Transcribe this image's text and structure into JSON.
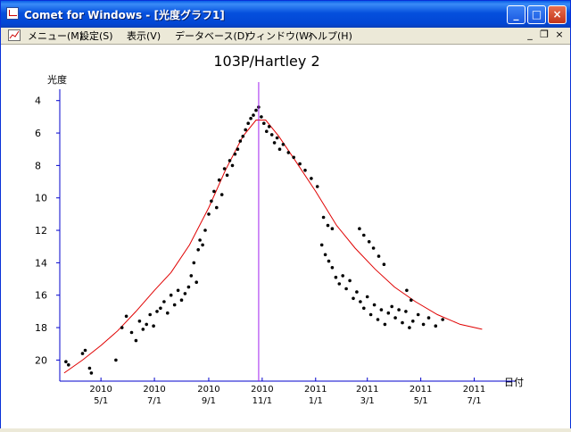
{
  "window": {
    "title": "Comet for Windows - [光度グラフ1]",
    "minimize_icon": "minimize-icon",
    "maximize_icon": "maximize-icon",
    "close_icon": "close-icon"
  },
  "menu": {
    "items": [
      {
        "label": "メニュー(M)"
      },
      {
        "label": "設定(S)"
      },
      {
        "label": "表示(V)"
      },
      {
        "label": "データベース(D)"
      },
      {
        "label": "ウィンドウ(W)"
      },
      {
        "label": "ヘルプ(H)"
      }
    ],
    "mdi_minimize": "_",
    "mdi_restore": "❐",
    "mdi_close": "×"
  },
  "chart_data": {
    "type": "scatter",
    "title": "103P/Hartley 2",
    "ylabel": "光度",
    "xlabel": "日付",
    "y_inverted": true,
    "ylim": [
      21.3,
      3.3
    ],
    "yticks": [
      4,
      6,
      8,
      10,
      12,
      14,
      16,
      18,
      20
    ],
    "xticks": [
      {
        "year": "2010",
        "date": "5/1"
      },
      {
        "year": "2010",
        "date": "7/1"
      },
      {
        "year": "2010",
        "date": "9/1"
      },
      {
        "year": "2010",
        "date": "11/1"
      },
      {
        "year": "2011",
        "date": "1/1"
      },
      {
        "year": "2011",
        "date": "3/1"
      },
      {
        "year": "2011",
        "date": "5/1"
      },
      {
        "year": "2011",
        "date": "7/1"
      }
    ],
    "perihelion_marker": "2010-10-28",
    "colors": {
      "observations": "#000000",
      "model_curve": "#e00000",
      "perihelion_line": "#a020f0",
      "axis": "#0000cc"
    },
    "model_curve": [
      {
        "x": "2010-03-20",
        "y": 20.8
      },
      {
        "x": "2010-04-10",
        "y": 20.0
      },
      {
        "x": "2010-05-01",
        "y": 19.1
      },
      {
        "x": "2010-05-20",
        "y": 18.2
      },
      {
        "x": "2010-06-10",
        "y": 17.0
      },
      {
        "x": "2010-07-01",
        "y": 15.7
      },
      {
        "x": "2010-07-20",
        "y": 14.6
      },
      {
        "x": "2010-08-10",
        "y": 12.9
      },
      {
        "x": "2010-09-01",
        "y": 10.6
      },
      {
        "x": "2010-09-20",
        "y": 8.3
      },
      {
        "x": "2010-10-10",
        "y": 6.2
      },
      {
        "x": "2010-10-25",
        "y": 5.2
      },
      {
        "x": "2010-11-05",
        "y": 5.2
      },
      {
        "x": "2010-11-20",
        "y": 6.2
      },
      {
        "x": "2010-12-10",
        "y": 7.8
      },
      {
        "x": "2011-01-01",
        "y": 9.6
      },
      {
        "x": "2011-01-25",
        "y": 11.7
      },
      {
        "x": "2011-02-15",
        "y": 13.1
      },
      {
        "x": "2011-03-10",
        "y": 14.4
      },
      {
        "x": "2011-04-01",
        "y": 15.5
      },
      {
        "x": "2011-04-25",
        "y": 16.4
      },
      {
        "x": "2011-05-20",
        "y": 17.2
      },
      {
        "x": "2011-06-15",
        "y": 17.8
      },
      {
        "x": "2011-07-10",
        "y": 18.1
      }
    ],
    "observations": [
      {
        "x": "2010-03-22",
        "y": 20.1
      },
      {
        "x": "2010-03-25",
        "y": 20.3
      },
      {
        "x": "2010-04-10",
        "y": 19.6
      },
      {
        "x": "2010-04-13",
        "y": 19.4
      },
      {
        "x": "2010-04-18",
        "y": 20.5
      },
      {
        "x": "2010-04-20",
        "y": 20.8
      },
      {
        "x": "2010-05-18",
        "y": 20.0
      },
      {
        "x": "2010-05-25",
        "y": 18.0
      },
      {
        "x": "2010-05-30",
        "y": 17.3
      },
      {
        "x": "2010-06-05",
        "y": 18.3
      },
      {
        "x": "2010-06-10",
        "y": 18.8
      },
      {
        "x": "2010-06-14",
        "y": 17.6
      },
      {
        "x": "2010-06-18",
        "y": 18.1
      },
      {
        "x": "2010-06-22",
        "y": 17.8
      },
      {
        "x": "2010-06-26",
        "y": 17.2
      },
      {
        "x": "2010-06-30",
        "y": 17.9
      },
      {
        "x": "2010-07-04",
        "y": 17.0
      },
      {
        "x": "2010-07-08",
        "y": 16.8
      },
      {
        "x": "2010-07-12",
        "y": 16.4
      },
      {
        "x": "2010-07-16",
        "y": 17.1
      },
      {
        "x": "2010-07-20",
        "y": 16.0
      },
      {
        "x": "2010-07-24",
        "y": 16.6
      },
      {
        "x": "2010-07-28",
        "y": 15.7
      },
      {
        "x": "2010-08-01",
        "y": 16.3
      },
      {
        "x": "2010-08-05",
        "y": 15.9
      },
      {
        "x": "2010-08-09",
        "y": 15.5
      },
      {
        "x": "2010-08-12",
        "y": 14.8
      },
      {
        "x": "2010-08-15",
        "y": 14.0
      },
      {
        "x": "2010-08-18",
        "y": 15.2
      },
      {
        "x": "2010-08-20",
        "y": 13.2
      },
      {
        "x": "2010-08-22",
        "y": 12.6
      },
      {
        "x": "2010-08-25",
        "y": 12.9
      },
      {
        "x": "2010-08-28",
        "y": 12.0
      },
      {
        "x": "2010-09-01",
        "y": 11.0
      },
      {
        "x": "2010-09-04",
        "y": 10.2
      },
      {
        "x": "2010-09-07",
        "y": 9.6
      },
      {
        "x": "2010-09-10",
        "y": 10.6
      },
      {
        "x": "2010-09-13",
        "y": 8.9
      },
      {
        "x": "2010-09-16",
        "y": 9.8
      },
      {
        "x": "2010-09-19",
        "y": 8.2
      },
      {
        "x": "2010-09-22",
        "y": 8.6
      },
      {
        "x": "2010-09-25",
        "y": 7.7
      },
      {
        "x": "2010-09-28",
        "y": 8.0
      },
      {
        "x": "2010-10-01",
        "y": 7.3
      },
      {
        "x": "2010-10-04",
        "y": 7.0
      },
      {
        "x": "2010-10-07",
        "y": 6.5
      },
      {
        "x": "2010-10-10",
        "y": 6.2
      },
      {
        "x": "2010-10-13",
        "y": 5.8
      },
      {
        "x": "2010-10-16",
        "y": 5.4
      },
      {
        "x": "2010-10-19",
        "y": 5.1
      },
      {
        "x": "2010-10-22",
        "y": 4.9
      },
      {
        "x": "2010-10-25",
        "y": 4.6
      },
      {
        "x": "2010-10-28",
        "y": 4.4
      },
      {
        "x": "2010-10-31",
        "y": 5.0
      },
      {
        "x": "2010-11-03",
        "y": 5.4
      },
      {
        "x": "2010-11-06",
        "y": 5.9
      },
      {
        "x": "2010-11-09",
        "y": 5.6
      },
      {
        "x": "2010-11-12",
        "y": 6.1
      },
      {
        "x": "2010-11-15",
        "y": 6.6
      },
      {
        "x": "2010-11-18",
        "y": 6.3
      },
      {
        "x": "2010-11-21",
        "y": 7.0
      },
      {
        "x": "2010-11-25",
        "y": 6.7
      },
      {
        "x": "2010-12-01",
        "y": 7.2
      },
      {
        "x": "2010-12-07",
        "y": 7.5
      },
      {
        "x": "2010-12-14",
        "y": 7.9
      },
      {
        "x": "2010-12-20",
        "y": 8.3
      },
      {
        "x": "2010-12-27",
        "y": 8.8
      },
      {
        "x": "2011-01-03",
        "y": 9.3
      },
      {
        "x": "2011-01-08",
        "y": 12.9
      },
      {
        "x": "2011-01-12",
        "y": 13.5
      },
      {
        "x": "2011-01-16",
        "y": 13.9
      },
      {
        "x": "2011-01-20",
        "y": 14.3
      },
      {
        "x": "2011-01-24",
        "y": 14.9
      },
      {
        "x": "2011-01-28",
        "y": 15.3
      },
      {
        "x": "2011-02-01",
        "y": 14.8
      },
      {
        "x": "2011-02-05",
        "y": 15.6
      },
      {
        "x": "2011-02-09",
        "y": 15.1
      },
      {
        "x": "2011-02-13",
        "y": 16.2
      },
      {
        "x": "2011-02-17",
        "y": 15.8
      },
      {
        "x": "2011-02-21",
        "y": 16.4
      },
      {
        "x": "2011-02-25",
        "y": 16.8
      },
      {
        "x": "2011-03-01",
        "y": 16.1
      },
      {
        "x": "2011-03-05",
        "y": 17.2
      },
      {
        "x": "2011-03-09",
        "y": 16.6
      },
      {
        "x": "2011-03-13",
        "y": 17.5
      },
      {
        "x": "2011-03-17",
        "y": 16.9
      },
      {
        "x": "2011-03-21",
        "y": 17.8
      },
      {
        "x": "2011-03-25",
        "y": 17.1
      },
      {
        "x": "2011-03-29",
        "y": 16.7
      },
      {
        "x": "2011-04-02",
        "y": 17.4
      },
      {
        "x": "2011-04-06",
        "y": 16.9
      },
      {
        "x": "2011-04-10",
        "y": 17.7
      },
      {
        "x": "2011-04-14",
        "y": 17.0
      },
      {
        "x": "2011-04-18",
        "y": 18.0
      },
      {
        "x": "2011-04-22",
        "y": 17.6
      },
      {
        "x": "2011-04-28",
        "y": 17.2
      },
      {
        "x": "2011-05-04",
        "y": 17.8
      },
      {
        "x": "2011-05-10",
        "y": 17.4
      },
      {
        "x": "2011-05-18",
        "y": 17.9
      },
      {
        "x": "2011-05-26",
        "y": 17.5
      },
      {
        "x": "2011-01-10",
        "y": 11.2
      },
      {
        "x": "2011-01-15",
        "y": 11.7
      },
      {
        "x": "2011-01-20",
        "y": 11.9
      },
      {
        "x": "2011-02-20",
        "y": 11.9
      },
      {
        "x": "2011-02-25",
        "y": 12.3
      },
      {
        "x": "2011-03-03",
        "y": 12.7
      },
      {
        "x": "2011-03-08",
        "y": 13.1
      },
      {
        "x": "2011-03-14",
        "y": 13.6
      },
      {
        "x": "2011-03-20",
        "y": 14.1
      },
      {
        "x": "2011-04-15",
        "y": 15.7
      },
      {
        "x": "2011-04-20",
        "y": 16.3
      }
    ]
  }
}
